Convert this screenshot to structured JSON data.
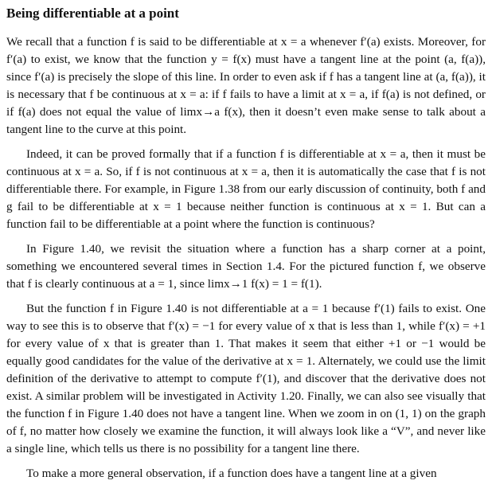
{
  "section": {
    "title": "Being differentiable at a point"
  },
  "paragraphs": [
    "We recall that a function f is said to be differentiable at x = a whenever f′(a) exists. Moreover, for f′(a) to exist, we know that the function y = f(x) must have a tangent line at the point (a, f(a)), since f′(a) is precisely the slope of this line. In order to even ask if f has a tangent line at (a, f(a)), it is necessary that f be continuous at x = a: if f fails to have a limit at x = a, if f(a) is not defined, or if f(a) does not equal the value of limx→a f(x), then it doesn’t even make sense to talk about a tangent line to the curve at this point.",
    "Indeed, it can be proved formally that if a function f is differentiable at x = a, then it must be continuous at x = a. So, if f is not continuous at x = a, then it is automatically the case that f is not differentiable there. For example, in Figure 1.38 from our early discussion of continuity, both f and g fail to be differentiable at x = 1 because neither function is continuous at x = 1. But can a function fail to be differentiable at a point where the function is continuous?",
    "In Figure 1.40, we revisit the situation where a function has a sharp corner at a point, something we encountered several times in Section 1.4. For the pictured function f, we observe that f is clearly continuous at a = 1, since limx→1 f(x) = 1 = f(1).",
    "But the function f in Figure 1.40 is not differentiable at a = 1 because f′(1) fails to exist. One way to see this is to observe that f′(x) = −1 for every value of x that is less than 1, while f′(x) = +1 for every value of x that is greater than 1. That makes it seem that either +1 or −1 would be equally good candidates for the value of the derivative at x = 1. Alternately, we could use the limit definition of the derivative to attempt to compute f′(1), and discover that the derivative does not exist. A similar problem will be investigated in Activity 1.20. Finally, we can also see visually that the function f in Figure 1.40 does not have a tangent line. When we zoom in on (1, 1) on the graph of f, no matter how closely we examine the function, it will always look like a “V”, and never like a single line, which tells us there is no possibility for a tangent line there.",
    "To make a more general observation, if a function does have a tangent line at a given"
  ]
}
